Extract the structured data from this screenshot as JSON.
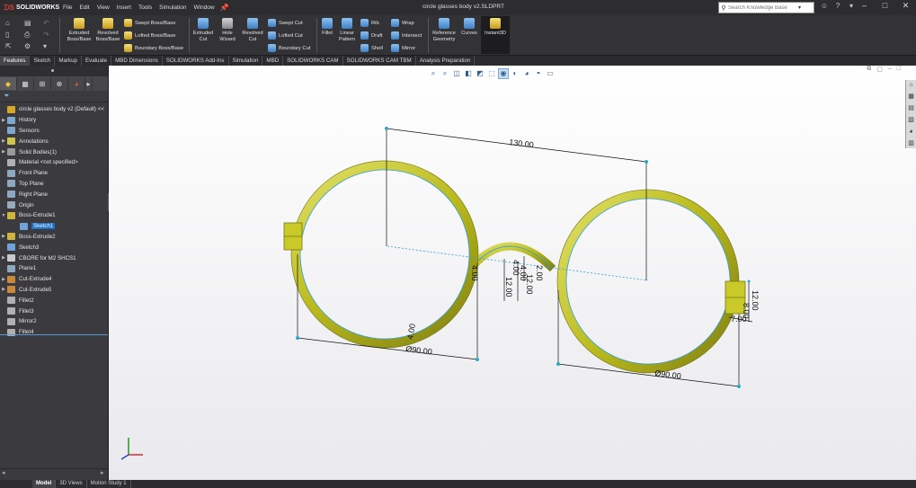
{
  "app": {
    "logo_text": "SOLIDWORKS",
    "menu": [
      "File",
      "Edit",
      "View",
      "Insert",
      "Tools",
      "Simulation",
      "Window"
    ],
    "document_title": "circle glasses body v2.SLDPRT",
    "search_placeholder": "Search Knowledge Base",
    "window_controls": [
      "–",
      "□",
      "✕"
    ]
  },
  "ribbon": {
    "features": {
      "extruded_boss": "Extruded\nBoss/Base",
      "revolved_boss": "Revolved\nBoss/Base",
      "swept_boss": "Swept Boss/Base",
      "lofted_boss": "Lofted Boss/Base",
      "boundary_boss": "Boundary Boss/Base",
      "extruded_cut": "Extruded\nCut",
      "hole_wizard": "Hole\nWizard",
      "revolved_cut": "Revolved\nCut",
      "swept_cut": "Swept Cut",
      "lofted_cut": "Lofted Cut",
      "boundary_cut": "Boundary Cut",
      "fillet": "Fillet",
      "linear_pattern": "Linear\nPattern",
      "rib": "Rib",
      "draft": "Draft",
      "shell": "Shell",
      "wrap": "Wrap",
      "intersect": "Intersect",
      "mirror": "Mirror",
      "reference_geometry": "Reference\nGeometry",
      "curves": "Curves",
      "instant3d": "Instant3D"
    }
  },
  "tabs": [
    "Features",
    "Sketch",
    "Markup",
    "Evaluate",
    "MBD Dimensions",
    "SOLIDWORKS Add-Ins",
    "Simulation",
    "MBD",
    "SOLIDWORKS CAM",
    "SOLIDWORKS CAM TBM",
    "Analysis Preparation"
  ],
  "active_tab": "Features",
  "feature_tree": {
    "items": [
      {
        "label": "circle glasses body v2 (Default) <<",
        "arrow": "",
        "icon": "#d7a72a"
      },
      {
        "label": "History",
        "arrow": "▶",
        "icon": "#7fa7c9"
      },
      {
        "label": "Sensors",
        "arrow": "",
        "icon": "#7fa7c9"
      },
      {
        "label": "Annotations",
        "arrow": "▶",
        "icon": "#d0c54f"
      },
      {
        "label": "Solid Bodies(1)",
        "arrow": "▶",
        "icon": "#9a9a9a"
      },
      {
        "label": "Material <not specified>",
        "arrow": "",
        "icon": "#b0b0b0"
      },
      {
        "label": "Front Plane",
        "arrow": "",
        "icon": "#8fa8c2"
      },
      {
        "label": "Top Plane",
        "arrow": "",
        "icon": "#8fa8c2"
      },
      {
        "label": "Right Plane",
        "arrow": "",
        "icon": "#8fa8c2"
      },
      {
        "label": "Origin",
        "arrow": "",
        "icon": "#9ab"
      },
      {
        "label": "Boss-Extrude1",
        "arrow": "▼",
        "icon": "#d0b33a"
      },
      {
        "label": "Sketch1",
        "arrow": "",
        "icon": "#6fa3d8",
        "selected": true
      },
      {
        "label": "Boss-Extrude2",
        "arrow": "▶",
        "icon": "#d0b33a"
      },
      {
        "label": "Sketch3",
        "arrow": "",
        "icon": "#6fa3d8"
      },
      {
        "label": "CBORE for M2 SHCS1",
        "arrow": "▶",
        "icon": "#c9c9c9"
      },
      {
        "label": "Plane1",
        "arrow": "",
        "icon": "#8fa8c2"
      },
      {
        "label": "Cut-Extrude4",
        "arrow": "▶",
        "icon": "#c68a3a"
      },
      {
        "label": "Cut-Extrude5",
        "arrow": "▶",
        "icon": "#c68a3a"
      },
      {
        "label": "Fillet2",
        "arrow": "",
        "icon": "#b0b0b0"
      },
      {
        "label": "Fillet3",
        "arrow": "",
        "icon": "#b0b0b0"
      },
      {
        "label": "Mirror2",
        "arrow": "",
        "icon": "#b0b0b0"
      },
      {
        "label": "Fillet4",
        "arrow": "",
        "icon": "#b0b0b0"
      }
    ]
  },
  "model": {
    "frame_color": "#b9b91e",
    "sketch_color": "#2f9fd6",
    "dimensions": {
      "width": "130.00",
      "left_diameter": "Ø90.00",
      "right_diameter": "Ø90.00",
      "left_ring_thickness": "4.00",
      "bridge_thickness": "4.00",
      "bridge_depth": "12.00",
      "bridge_small1": "4.00",
      "bridge_small2": "2.00",
      "bridge_height": "12.00",
      "hinge_height": "12.00",
      "hinge_width": "7.00",
      "hinge_small": "8.00",
      "left_small": "4.00"
    }
  },
  "bottom_tabs": [
    "Model",
    "3D Views",
    "Motion Study 1"
  ],
  "active_bottom_tab": "Model"
}
